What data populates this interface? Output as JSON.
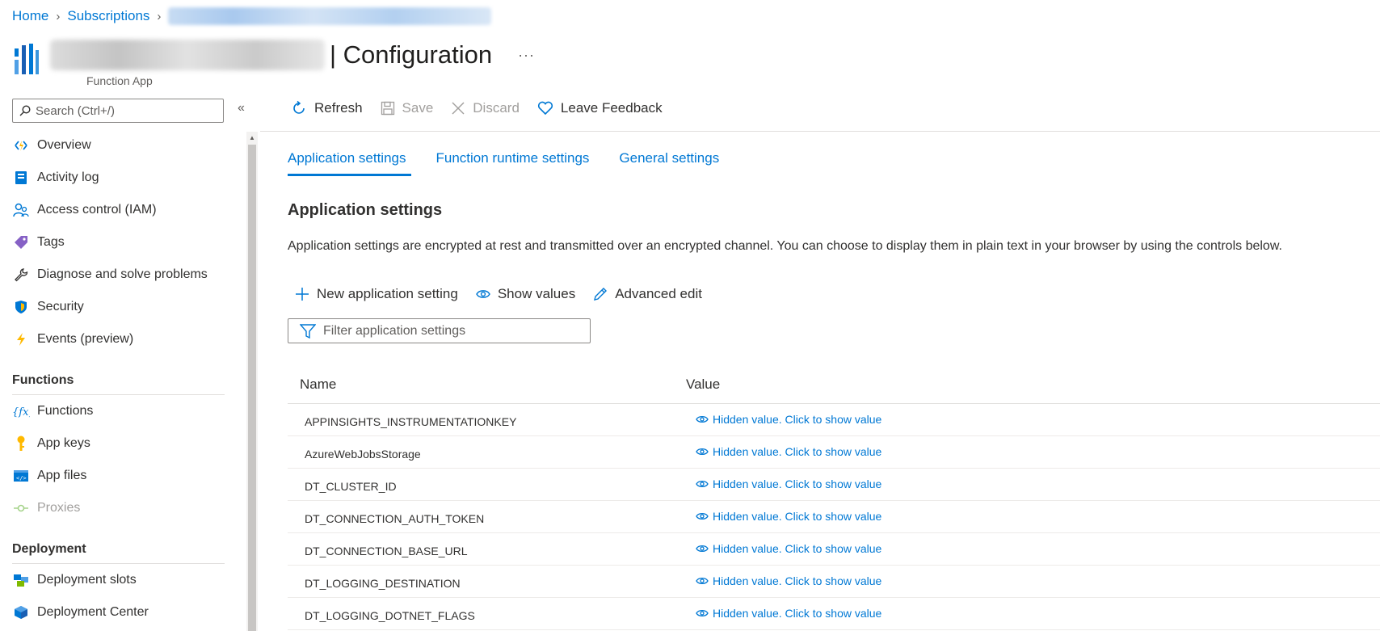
{
  "breadcrumb": {
    "home": "Home",
    "subscriptions": "Subscriptions"
  },
  "header": {
    "title": "| Configuration",
    "more": "···",
    "subtitle": "Function App"
  },
  "search": {
    "placeholder": "Search (Ctrl+/)"
  },
  "sidebar": {
    "items": [
      {
        "label": "Overview",
        "icon": "function-bolt-icon"
      },
      {
        "label": "Activity log",
        "icon": "activity-log-icon"
      },
      {
        "label": "Access control (IAM)",
        "icon": "people-icon"
      },
      {
        "label": "Tags",
        "icon": "tag-icon"
      },
      {
        "label": "Diagnose and solve problems",
        "icon": "wrench-icon"
      },
      {
        "label": "Security",
        "icon": "shield-icon"
      },
      {
        "label": "Events (preview)",
        "icon": "lightning-icon"
      }
    ],
    "functions_section": "Functions",
    "functions_items": [
      {
        "label": "Functions",
        "icon": "fx-icon"
      },
      {
        "label": "App keys",
        "icon": "key-icon"
      },
      {
        "label": "App files",
        "icon": "code-file-icon"
      },
      {
        "label": "Proxies",
        "icon": "proxy-icon",
        "disabled": true
      }
    ],
    "deployment_section": "Deployment",
    "deployment_items": [
      {
        "label": "Deployment slots",
        "icon": "slots-icon"
      },
      {
        "label": "Deployment Center",
        "icon": "cube-icon"
      }
    ]
  },
  "toolbar": {
    "refresh": "Refresh",
    "save": "Save",
    "discard": "Discard",
    "feedback": "Leave Feedback"
  },
  "tabs": [
    {
      "label": "Application settings",
      "active": true
    },
    {
      "label": "Function runtime settings",
      "active": false
    },
    {
      "label": "General settings",
      "active": false
    }
  ],
  "main": {
    "section_title": "Application settings",
    "description": "Application settings are encrypted at rest and transmitted over an encrypted channel. You can choose to display them in plain text in your browser by using the controls below.",
    "new_setting": "New application setting",
    "show_values": "Show values",
    "advanced_edit": "Advanced edit",
    "filter_placeholder": "Filter application settings"
  },
  "table": {
    "columns": [
      "Name",
      "Value"
    ],
    "rows": [
      {
        "name": "APPINSIGHTS_INSTRUMENTATIONKEY",
        "value": "Hidden value. Click to show value"
      },
      {
        "name": "AzureWebJobsStorage",
        "value": "Hidden value. Click to show value"
      },
      {
        "name": "DT_CLUSTER_ID",
        "value": "Hidden value. Click to show value"
      },
      {
        "name": "DT_CONNECTION_AUTH_TOKEN",
        "value": "Hidden value. Click to show value"
      },
      {
        "name": "DT_CONNECTION_BASE_URL",
        "value": "Hidden value. Click to show value"
      },
      {
        "name": "DT_LOGGING_DESTINATION",
        "value": "Hidden value. Click to show value"
      },
      {
        "name": "DT_LOGGING_DOTNET_FLAGS",
        "value": "Hidden value. Click to show value"
      }
    ]
  },
  "colors": {
    "accent": "#0078d4",
    "text": "#323130",
    "disabled": "#a19f9d"
  }
}
